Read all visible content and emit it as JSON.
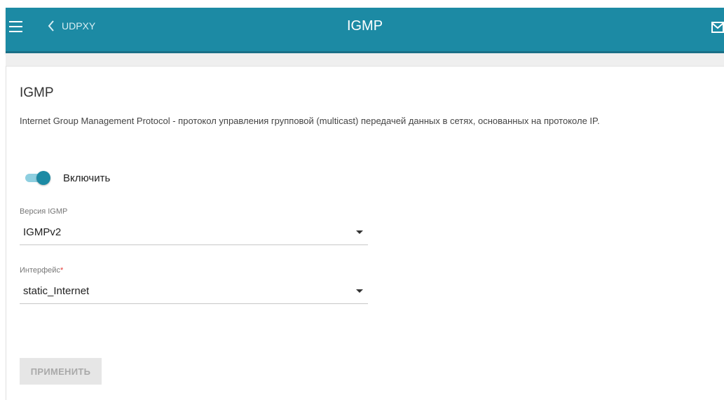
{
  "header": {
    "back_label": "UDPXY",
    "title": "IGMP"
  },
  "section": {
    "title": "IGMP",
    "description": "Internet Group Management Protocol - протокол управления групповой (multicast) передачей данных в сетях, основанных на протоколе IP."
  },
  "enable_toggle": {
    "label": "Включить",
    "state": "on"
  },
  "igmp_version": {
    "label": "Версия IGMP",
    "value": "IGMPv2"
  },
  "interface": {
    "label": "Интерфейс",
    "required_mark": "*",
    "value": "static_Internet"
  },
  "apply_button": {
    "label": "ПРИМЕНИТЬ"
  },
  "colors": {
    "header_bg": "#1c8aa4",
    "toggle_on": "#1c8aa4",
    "required": "#e53935"
  },
  "icons": {
    "menu": "hamburger-menu-icon",
    "back": "chevron-left-icon",
    "mail": "mail-icon",
    "dropdown": "caret-down-icon"
  }
}
